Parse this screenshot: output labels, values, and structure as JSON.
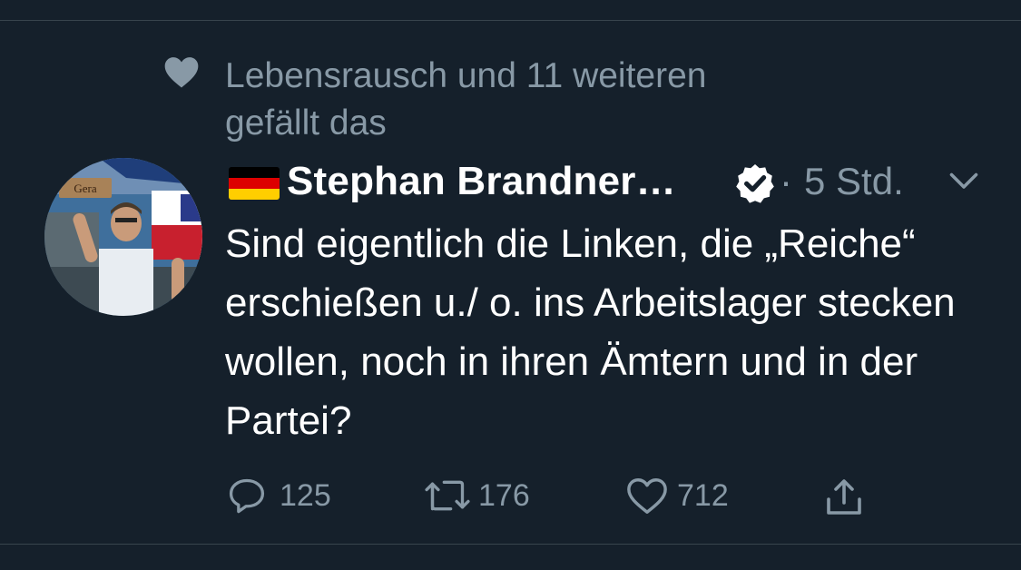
{
  "social_context": {
    "icon": "heart-icon",
    "text": "Lebensrausch und 11 weiteren gefällt das"
  },
  "tweet": {
    "author_flag": "german-flag-icon",
    "author_name": "Stephan Brandner…",
    "verified_icon": "verified-badge-icon",
    "separator": "·",
    "timestamp": "5 Std.",
    "menu_icon": "chevron-down-icon",
    "text": "Sind eigentlich die Linken, die „Reiche“ erschießen u./ o. ins Arbeitslager stecken wollen, noch in ihren Ämtern und in der Partei?",
    "avatar_sign": "Gera"
  },
  "actions": {
    "reply_count": "125",
    "retweet_count": "176",
    "like_count": "712"
  },
  "colors": {
    "background": "#15202b",
    "secondary_text": "#8899a6",
    "primary_text": "#ffffff",
    "divider": "#38444d"
  }
}
